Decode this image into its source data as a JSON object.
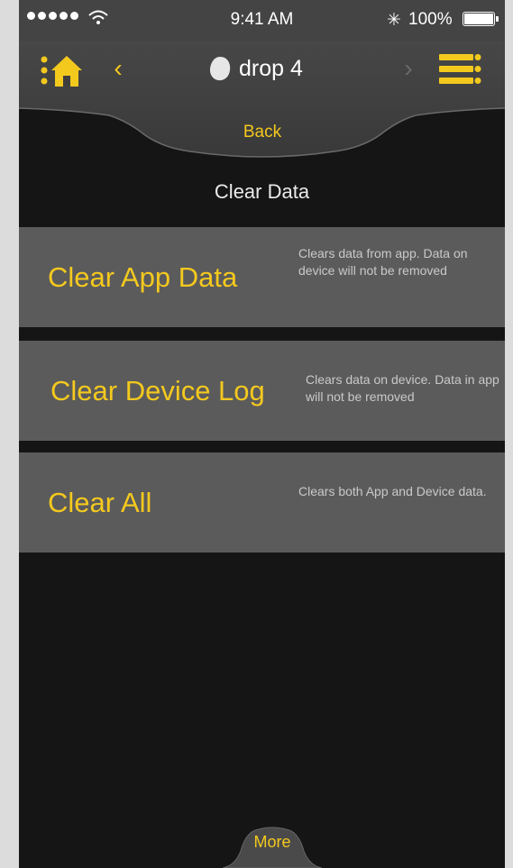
{
  "status_bar": {
    "time": "9:41 AM",
    "battery": "100%",
    "bluetooth_icon": "bluetooth-icon",
    "wifi_icon": "wifi-icon"
  },
  "nav": {
    "device_name": "drop 4",
    "back_label": "Back",
    "prev_icon": "chevron-left-icon",
    "next_icon": "chevron-right-icon",
    "home_icon": "home-icon",
    "menu_icon": "menu-icon"
  },
  "page": {
    "title": "Clear Data"
  },
  "options": [
    {
      "label": "Clear App Data",
      "description": "Clears data from app. Data on device will not be removed"
    },
    {
      "label": "Clear Device Log",
      "description": "Clears data on device. Data in app will not be removed"
    },
    {
      "label": "Clear All",
      "description": "Clears both App and Device data."
    }
  ],
  "footer": {
    "more_label": "More"
  },
  "colors": {
    "accent": "#f4c91e",
    "option_bg": "#5b5b5b",
    "background": "#151515",
    "status_bar": "#444444"
  }
}
